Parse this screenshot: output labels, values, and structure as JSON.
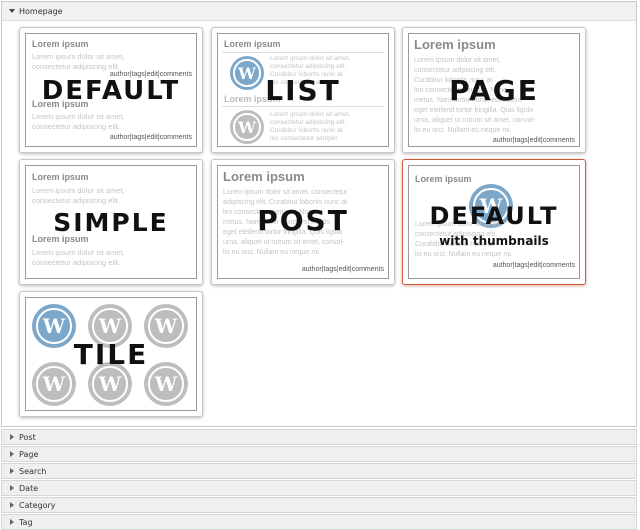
{
  "panel": {
    "title": "Homepage"
  },
  "cards": {
    "default": {
      "label": "DEFAULT",
      "heading1": "Lorem ipsum",
      "body1": "Lorem ipsum dolor sit amet,",
      "body1b": "consectetur adipiscing elit.",
      "meta1": "author|tags|edit|comments",
      "heading2": "Lorem ipsum",
      "body2": "Lorem ipsum dolor sit amet,",
      "body2b": "consectetur adipiscing elit.",
      "meta2": "author|tags|edit|comments"
    },
    "list": {
      "label": "LIST",
      "heading1": "Lorem ipsum",
      "heading2": "Lorem ipsum",
      "l1": "Lorem ipsum dolor sit amet,",
      "l2": "consectetur adipiscing elit.",
      "l3": "Curabitur lobortis nunc at",
      "l4": "leo consectetur semper.",
      "m1": "Lorem ipsum dolor sit amet,",
      "m2": "consectetur adipiscing elit.",
      "m3": "Curabitur lobortis nunc at",
      "m4": "leo consectetur semper."
    },
    "page": {
      "label": "PAGE",
      "heading": "Lorem ipsum",
      "l1": "Lorem ipsum dolor sit amet,",
      "l2": "consectetur adipiscing elit.",
      "l3": "Curabitur lobortis nunc at",
      "l4": "leo consectetur semper. Nunc",
      "l5": "metus. Nam tortor nunc, est mattis",
      "l6": "eget eleifend tortor fringilla. Quis ligula",
      "l7": "urna, aliquet ut rutrum sit amet, conval-",
      "l8": "lis eu orci. Nullam eu neque mi.",
      "meta": "author|tags|edit|comments"
    },
    "simple": {
      "label": "SIMPLE",
      "heading1": "Lorem ipsum",
      "body1": "Lorem ipsum dolor sit amet,",
      "body1b": "consectetur adipiscing elit.",
      "heading2": "Lorem ipsum",
      "body2": "Lorem ipsum dolor sit amet,",
      "body2b": "consectetur adipiscing elit."
    },
    "post": {
      "label": "POST",
      "heading": "Lorem ipsum",
      "l1": "Lorem ipsum dolor sit amet, consectetur",
      "l2": "adipiscing elit. Curabitur lobortis nunc at",
      "l3": "leo consectetur semper. Nunc",
      "l4": "metus. Nam tortor nunc, est mattis",
      "l5": "eget eleifend tortor fringilla. Quis ligula",
      "l6": "urna, aliquet ut rutrum sit amet, conval-",
      "l7": "lis eu orci. Nullam eu neque mi.",
      "meta": "author|tags|edit|comments"
    },
    "thumbs": {
      "label": "DEFAULT",
      "sublabel": "with thumbnails",
      "heading": "Lorem ipsum",
      "l1": "Lorem ipsum dolor sit amet,",
      "l2": "consectetur adipiscing elit.",
      "l3": "Curabitur lobortis nunc at",
      "l4": "lis eu orci. Nullam eu neque mi.",
      "meta": "author|tags|edit|comments"
    },
    "tile": {
      "label": "TILE"
    }
  },
  "accordion": [
    {
      "label": "Post"
    },
    {
      "label": "Page"
    },
    {
      "label": "Search"
    },
    {
      "label": "Date"
    },
    {
      "label": "Category"
    },
    {
      "label": "Tag"
    }
  ],
  "icons": {
    "wp_glyph": "W",
    "blue": "#7da7c9",
    "grey": "#bdbdbd",
    "selected_border": "#d05a3c"
  }
}
